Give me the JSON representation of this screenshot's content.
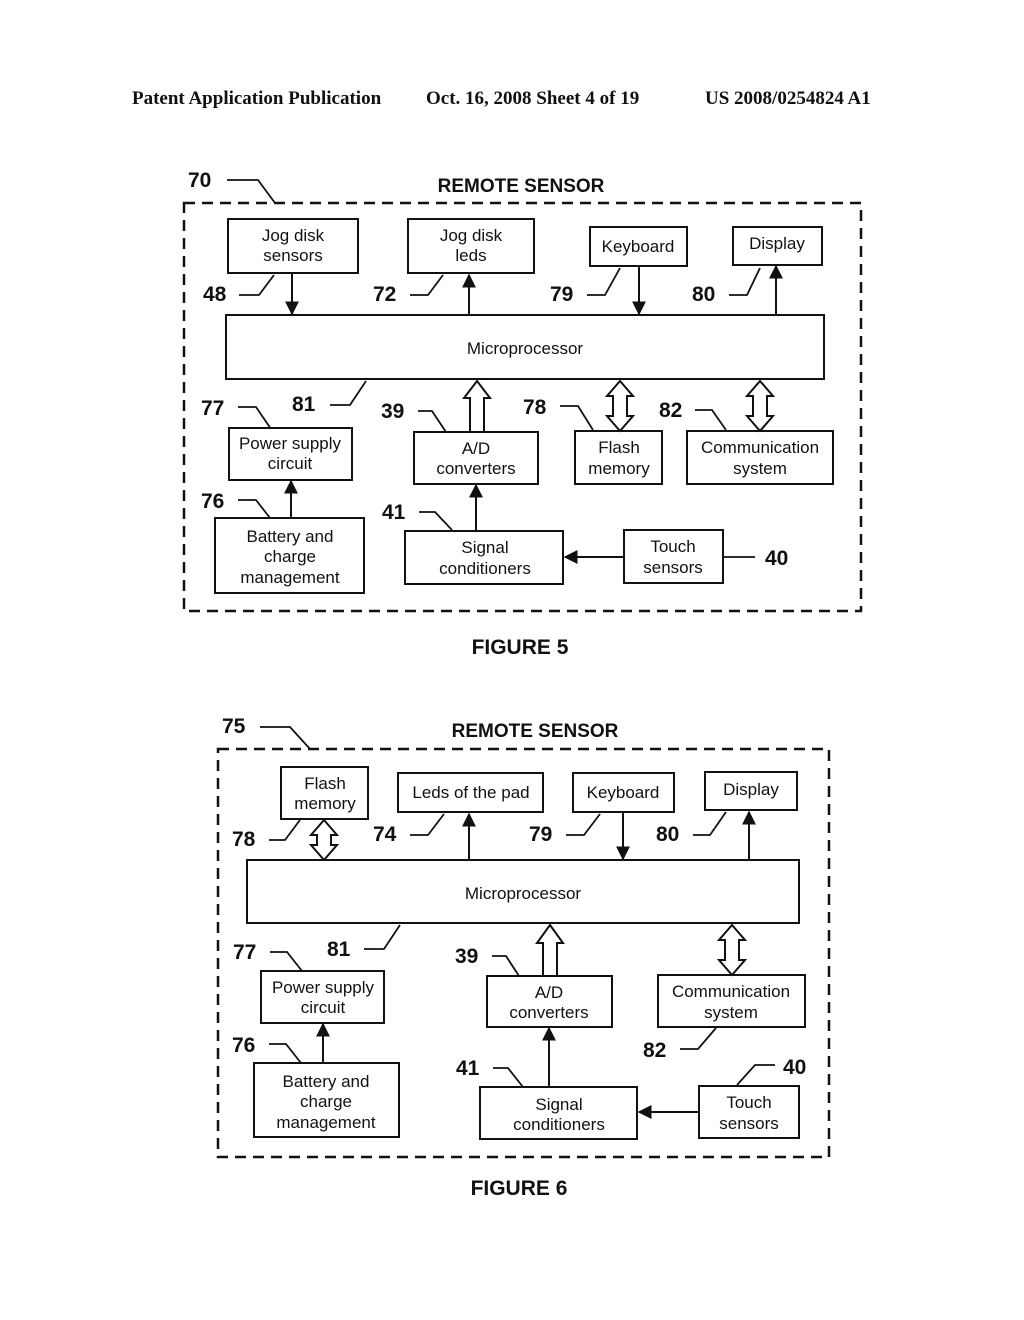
{
  "header": {
    "left": "Patent Application Publication",
    "middle": "Oct. 16, 2008  Sheet 4 of 19",
    "right": "US 2008/0254824 A1"
  },
  "figure5": {
    "caption": "FIGURE 5",
    "title": "REMOTE SENSOR",
    "ref_main": "70",
    "blocks": {
      "jog_sensors": {
        "lines": [
          "Jog disk",
          "sensors"
        ],
        "ref": "48"
      },
      "jog_leds": {
        "lines": [
          "Jog disk",
          "leds"
        ],
        "ref": "72"
      },
      "keyboard": {
        "lines": [
          "Keyboard"
        ],
        "ref": "79"
      },
      "display": {
        "lines": [
          "Display"
        ],
        "ref": "80"
      },
      "micro": {
        "lines": [
          "Microprocessor"
        ],
        "ref": "81"
      },
      "power": {
        "lines": [
          "Power supply",
          "circuit"
        ],
        "ref": "77"
      },
      "ad": {
        "lines": [
          "A/D",
          "converters"
        ],
        "ref": "39"
      },
      "flash": {
        "lines": [
          "Flash",
          "memory"
        ],
        "ref": "78"
      },
      "comm": {
        "lines": [
          "Communication",
          "system"
        ],
        "ref": "82"
      },
      "battery": {
        "lines": [
          "Battery and",
          "charge",
          "management"
        ],
        "ref": "76"
      },
      "signal": {
        "lines": [
          "Signal",
          "conditioners"
        ],
        "ref": "41"
      },
      "touch": {
        "lines": [
          "Touch",
          "sensors"
        ],
        "ref": "40"
      }
    }
  },
  "figure6": {
    "caption": "FIGURE 6",
    "title": "REMOTE SENSOR",
    "ref_main": "75",
    "blocks": {
      "flash": {
        "lines": [
          "Flash",
          "memory"
        ],
        "ref": "78"
      },
      "leds_pad": {
        "lines": [
          "Leds of the pad"
        ],
        "ref": "74"
      },
      "keyboard": {
        "lines": [
          "Keyboard"
        ],
        "ref": "79"
      },
      "display": {
        "lines": [
          "Display"
        ],
        "ref": "80"
      },
      "micro": {
        "lines": [
          "Microprocessor"
        ],
        "ref": "81"
      },
      "power": {
        "lines": [
          "Power supply",
          "circuit"
        ],
        "ref": "77"
      },
      "ad": {
        "lines": [
          "A/D",
          "converters"
        ],
        "ref": "39"
      },
      "comm": {
        "lines": [
          "Communication",
          "system"
        ],
        "ref": "82"
      },
      "battery": {
        "lines": [
          "Battery and",
          "charge",
          "management"
        ],
        "ref": "76"
      },
      "signal": {
        "lines": [
          "Signal",
          "conditioners"
        ],
        "ref": "41"
      },
      "touch": {
        "lines": [
          "Touch",
          "sensors"
        ],
        "ref": "40"
      }
    }
  }
}
